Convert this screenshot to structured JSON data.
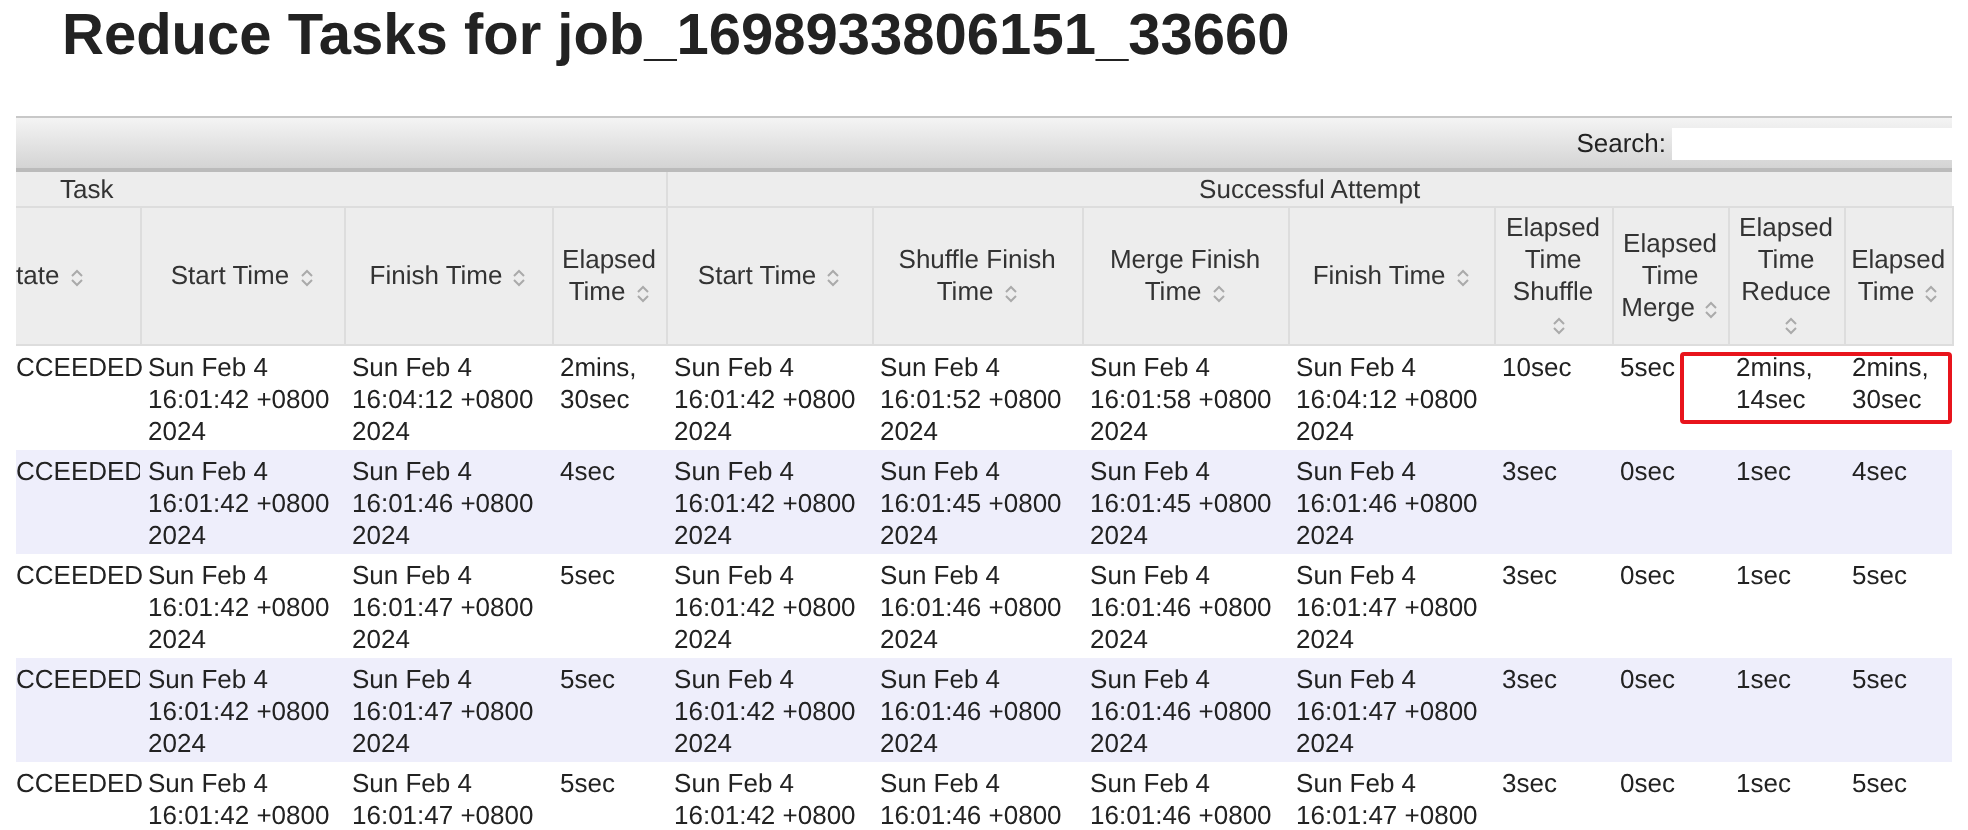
{
  "title": "Reduce Tasks for job_1698933806151_33660",
  "search": {
    "label": "Search:"
  },
  "column_groups": [
    {
      "label": "Task"
    },
    {
      "label": "Successful Attempt"
    }
  ],
  "columns": [
    "tate",
    "Start Time",
    "Finish Time",
    "Elapsed Time",
    "Start Time",
    "Shuffle Finish Time",
    "Merge Finish Time",
    "Finish Time",
    "Elapsed Time Shuffle",
    "Elapsed Time Merge",
    "Elapsed Time Reduce",
    "Elapsed Time"
  ],
  "rows": [
    {
      "highlighted": true,
      "cells": [
        "CCEEDED",
        "Sun Feb 4 16:01:42 +0800 2024",
        "Sun Feb 4 16:04:12 +0800 2024",
        "2mins, 30sec",
        "Sun Feb 4 16:01:42 +0800 2024",
        "Sun Feb 4 16:01:52 +0800 2024",
        "Sun Feb 4 16:01:58 +0800 2024",
        "Sun Feb 4 16:04:12 +0800 2024",
        "10sec",
        "5sec",
        "2mins, 14sec",
        "2mins, 30sec"
      ]
    },
    {
      "highlighted": false,
      "cells": [
        "CCEEDED",
        "Sun Feb 4 16:01:42 +0800 2024",
        "Sun Feb 4 16:01:46 +0800 2024",
        "4sec",
        "Sun Feb 4 16:01:42 +0800 2024",
        "Sun Feb 4 16:01:45 +0800 2024",
        "Sun Feb 4 16:01:45 +0800 2024",
        "Sun Feb 4 16:01:46 +0800 2024",
        "3sec",
        "0sec",
        "1sec",
        "4sec"
      ]
    },
    {
      "highlighted": false,
      "cells": [
        "CCEEDED",
        "Sun Feb 4 16:01:42 +0800 2024",
        "Sun Feb 4 16:01:47 +0800 2024",
        "5sec",
        "Sun Feb 4 16:01:42 +0800 2024",
        "Sun Feb 4 16:01:46 +0800 2024",
        "Sun Feb 4 16:01:46 +0800 2024",
        "Sun Feb 4 16:01:47 +0800 2024",
        "3sec",
        "0sec",
        "1sec",
        "5sec"
      ]
    },
    {
      "highlighted": false,
      "cells": [
        "CCEEDED",
        "Sun Feb 4 16:01:42 +0800 2024",
        "Sun Feb 4 16:01:47 +0800 2024",
        "5sec",
        "Sun Feb 4 16:01:42 +0800 2024",
        "Sun Feb 4 16:01:46 +0800 2024",
        "Sun Feb 4 16:01:46 +0800 2024",
        "Sun Feb 4 16:01:47 +0800 2024",
        "3sec",
        "0sec",
        "1sec",
        "5sec"
      ]
    },
    {
      "highlighted": false,
      "cells": [
        "CCEEDED",
        "Sun Feb 4 16:01:42 +0800",
        "Sun Feb 4 16:01:47 +0800",
        "5sec",
        "Sun Feb 4 16:01:42 +0800",
        "Sun Feb 4 16:01:46 +0800",
        "Sun Feb 4 16:01:46 +0800",
        "Sun Feb 4 16:01:47 +0800",
        "3sec",
        "0sec",
        "1sec",
        "5sec"
      ]
    }
  ]
}
